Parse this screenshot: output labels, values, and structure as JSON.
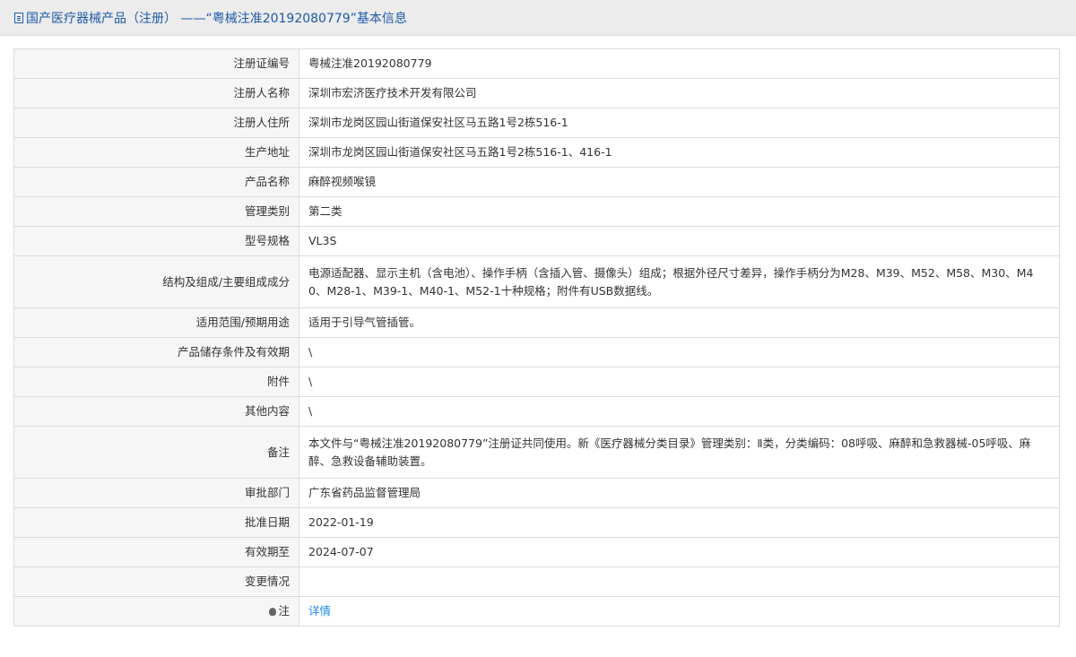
{
  "header": {
    "icon": "document-icon",
    "title": "国产医疗器械产品（注册） ——“粤械注准20192080779”基本信息"
  },
  "rows": [
    {
      "label": "注册证编号",
      "value": "粤械注准20192080779"
    },
    {
      "label": "注册人名称",
      "value": "深圳市宏济医疗技术开发有限公司"
    },
    {
      "label": "注册人住所",
      "value": "深圳市龙岗区园山街道保安社区马五路1号2栋516-1"
    },
    {
      "label": "生产地址",
      "value": "深圳市龙岗区园山街道保安社区马五路1号2栋516-1、416-1"
    },
    {
      "label": "产品名称",
      "value": "麻醉视频喉镜"
    },
    {
      "label": "管理类别",
      "value": "第二类"
    },
    {
      "label": "型号规格",
      "value": "VL3S"
    },
    {
      "label": "结构及组成/主要组成成分",
      "value": "电源适配器、显示主机（含电池）、操作手柄（含插入管、摄像头）组成；根据外径尺寸差异，操作手柄分为M28、M39、M52、M58、M30、M40、M28-1、M39-1、M40-1、M52-1十种规格；附件有USB数据线。"
    },
    {
      "label": "适用范围/预期用途",
      "value": "适用于引导气管插管。"
    },
    {
      "label": "产品储存条件及有效期",
      "value": "\\"
    },
    {
      "label": "附件",
      "value": "\\"
    },
    {
      "label": "其他内容",
      "value": "\\"
    },
    {
      "label": "备注",
      "value": "本文件与“粤械注准20192080779”注册证共同使用。新《医疗器械分类目录》管理类别：Ⅱ类，分类编码：08呼吸、麻醉和急救器械-05呼吸、麻醉、急救设备辅助装置。"
    },
    {
      "label": "审批部门",
      "value": "广东省药品监督管理局"
    },
    {
      "label": "批准日期",
      "value": "2022-01-19"
    },
    {
      "label": "有效期至",
      "value": "2024-07-07"
    },
    {
      "label": "变更情况",
      "value": ""
    }
  ],
  "note_row": {
    "icon": "lightbulb-icon",
    "label": "注",
    "link_text": "详情"
  }
}
